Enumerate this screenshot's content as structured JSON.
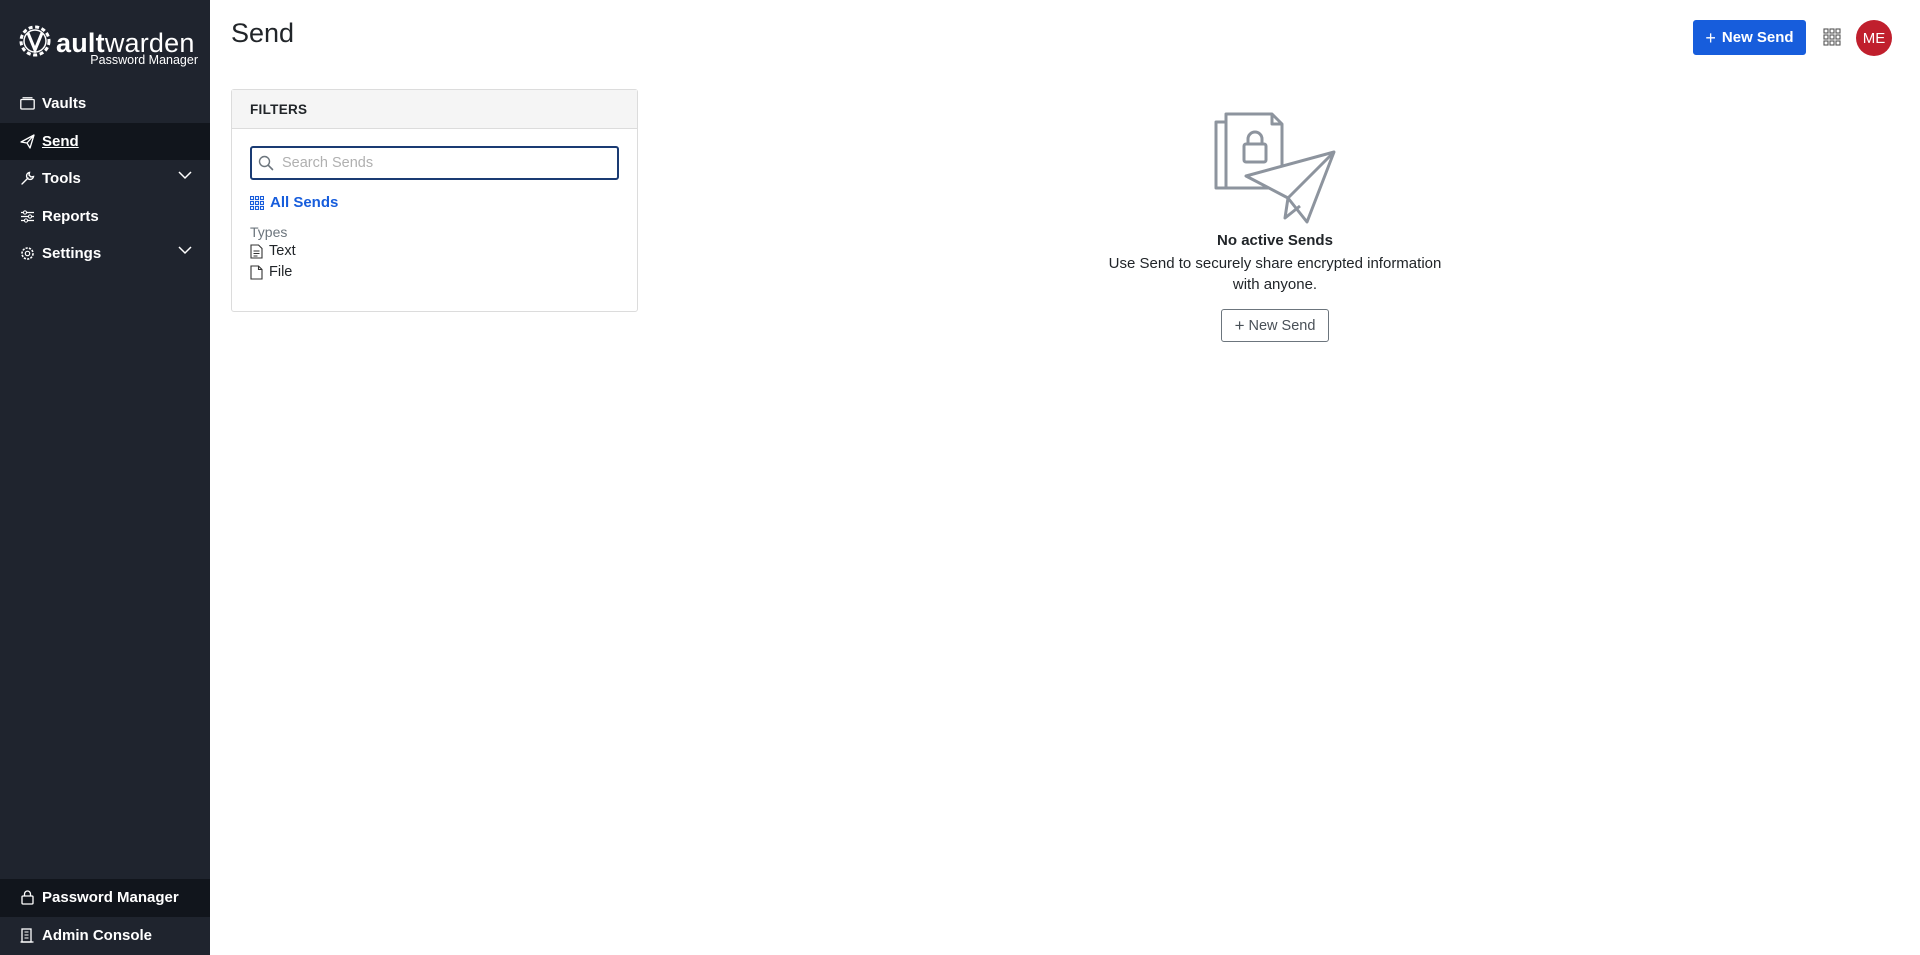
{
  "brand": {
    "name_light": "V",
    "name_bold": "ault",
    "name_rest": "warden",
    "subtitle": "Password Manager"
  },
  "sidebar": {
    "items": [
      {
        "label": "Vaults",
        "icon": "vault-icon"
      },
      {
        "label": "Send",
        "icon": "send-icon",
        "active": true
      },
      {
        "label": "Tools",
        "icon": "wrench-icon",
        "expandable": true
      },
      {
        "label": "Reports",
        "icon": "sliders-icon"
      },
      {
        "label": "Settings",
        "icon": "gear-icon",
        "expandable": true
      }
    ],
    "bottom": [
      {
        "label": "Password Manager",
        "icon": "lock-icon"
      },
      {
        "label": "Admin Console",
        "icon": "business-icon"
      }
    ]
  },
  "header": {
    "title": "Send",
    "new_send_label": "New Send",
    "avatar_initials": "ME"
  },
  "filters": {
    "heading": "FILTERS",
    "search_placeholder": "Search Sends",
    "search_value": "",
    "all_label": "All Sends",
    "types_label": "Types",
    "types": [
      {
        "label": "Text",
        "icon": "text-file-icon"
      },
      {
        "label": "File",
        "icon": "file-icon"
      }
    ]
  },
  "empty_state": {
    "title": "No active Sends",
    "message": "Use Send to securely share encrypted information with anyone.",
    "button_label": "New Send"
  },
  "colors": {
    "sidebar_bg": "#1f242e",
    "primary": "#175ddc",
    "avatar": "#c01f2d"
  }
}
